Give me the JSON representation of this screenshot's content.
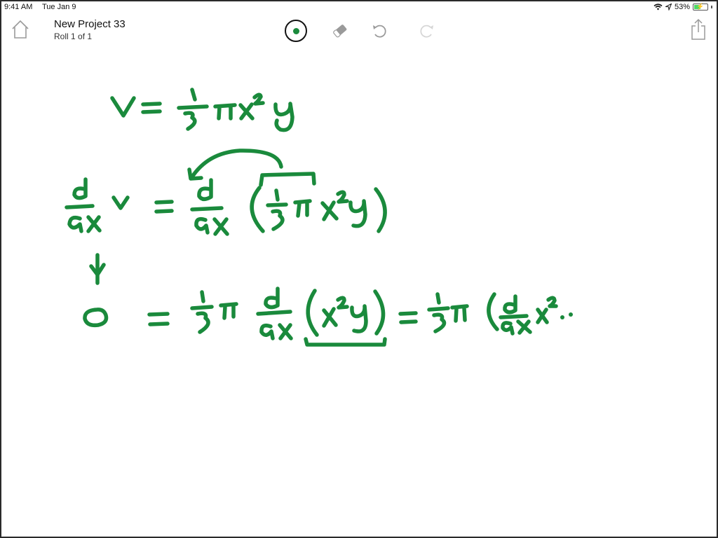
{
  "status_bar": {
    "time": "9:41 AM",
    "date": "Tue Jan 9",
    "battery_percent": "53%",
    "battery_level": 0.53,
    "charging": true,
    "icons": [
      "wifi-icon",
      "location-icon",
      "battery-icon"
    ]
  },
  "toolbar": {
    "home_icon": "home-icon",
    "title": "New Project 33",
    "subtitle": "Roll 1 of 1",
    "tools": [
      {
        "name": "pen",
        "icon": "pen-color-icon",
        "selected": true
      },
      {
        "name": "eraser",
        "icon": "eraser-icon",
        "selected": false
      },
      {
        "name": "undo",
        "icon": "undo-icon",
        "enabled": true
      },
      {
        "name": "redo",
        "icon": "redo-icon",
        "enabled": false
      }
    ],
    "share_icon": "share-icon"
  },
  "colors": {
    "ink": "#1a8a3c",
    "battery_fill": "#4cd964",
    "icon_gray": "#9a9a9a",
    "disabled_gray": "#d6d6d6"
  },
  "canvas": {
    "handwriting_lines": [
      "V = 1/3 π x² y",
      "d/dx V = d/dx ( 1/3 π x² y )",
      "↓",
      "0 = 1/3 π d/dx ( x² y ) = 1/3 π ( d/dx x² .."
    ]
  }
}
